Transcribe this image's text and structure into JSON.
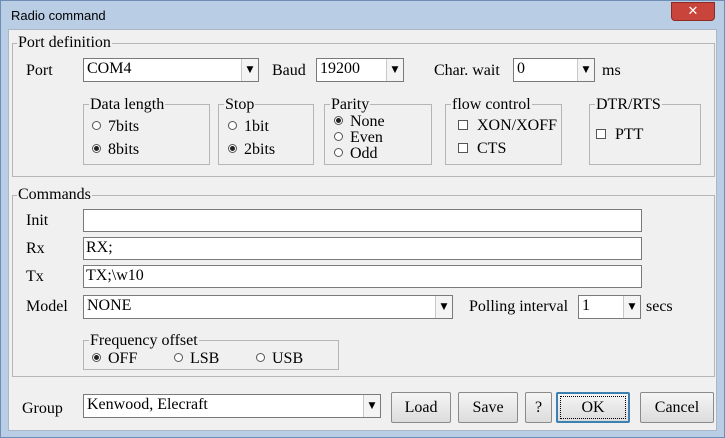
{
  "window": {
    "title": "Radio command",
    "close_symbol": "✕"
  },
  "port": {
    "group_title": "Port definition",
    "port_label": "Port",
    "port_value": "COM4",
    "baud_label": "Baud",
    "baud_value": "19200",
    "charwait_label": "Char. wait",
    "charwait_value": "0",
    "charwait_unit": "ms",
    "data_length": {
      "title": "Data length",
      "options": [
        "7bits",
        "8bits"
      ],
      "selected": "8bits"
    },
    "stop": {
      "title": "Stop",
      "options": [
        "1bit",
        "2bits"
      ],
      "selected": "2bits"
    },
    "parity": {
      "title": "Parity",
      "options": [
        "None",
        "Even",
        "Odd"
      ],
      "selected": "None"
    },
    "flow_control": {
      "title": "flow control",
      "options": [
        "XON/XOFF",
        "CTS"
      ],
      "checked": [
        false,
        false
      ]
    },
    "dtr_rts": {
      "title": "DTR/RTS",
      "options": [
        "PTT"
      ],
      "checked": [
        false
      ]
    }
  },
  "commands": {
    "group_title": "Commands",
    "init_label": "Init",
    "init_value": "",
    "rx_label": "Rx",
    "rx_value": "RX;",
    "tx_label": "Tx",
    "tx_value": "TX;\\w10",
    "model_label": "Model",
    "model_value": "NONE",
    "polling_label": "Polling interval",
    "polling_value": "1",
    "polling_unit": "secs",
    "frequency_offset": {
      "title": "Frequency offset",
      "options": [
        "OFF",
        "LSB",
        "USB"
      ],
      "selected": "OFF"
    }
  },
  "footer": {
    "group_label": "Group",
    "group_value": "Kenwood, Elecraft",
    "load_label": "Load",
    "save_label": "Save",
    "help_label": "?",
    "ok_label": "OK",
    "cancel_label": "Cancel"
  },
  "icons": {
    "dropdown": "▼"
  }
}
